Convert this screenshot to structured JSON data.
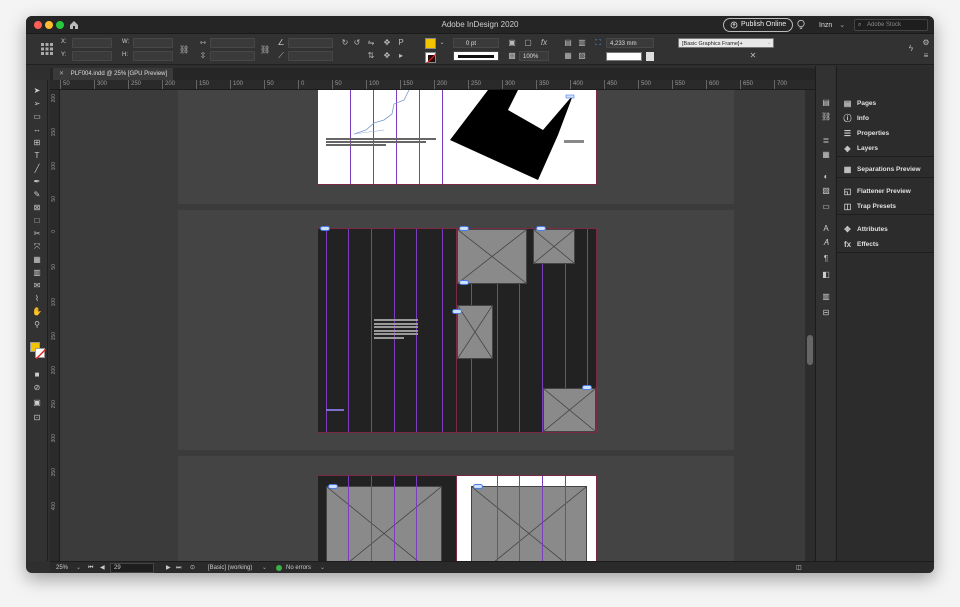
{
  "app": {
    "title": "Adobe InDesign 2020",
    "publish_label": "Publish Online",
    "workspace": "Inzn",
    "stock_placeholder": "Adobe Stock"
  },
  "colors": {
    "accent_fill": "#f5c400",
    "frame_gray": "#8a8a8a",
    "column_guide": "#7c3cbf",
    "margin_guide": "#7a2a45",
    "status_ok": "#3cb043"
  },
  "control_bar": {
    "x_label": "X:",
    "y_label": "Y:",
    "w_label": "W:",
    "h_label": "H:",
    "stroke_weight": "0 pt",
    "reference_value": "4,233 mm",
    "opacity": "100%",
    "object_style": "[Basic Graphics Frame]+"
  },
  "document": {
    "tab_label": "PLF004.indd @ 25% [GPU Preview]"
  },
  "ruler": {
    "h_ticks": [
      "50",
      "300",
      "250",
      "200",
      "150",
      "100",
      "50",
      "0",
      "50",
      "100",
      "150",
      "200",
      "250",
      "300",
      "350",
      "400",
      "450",
      "500",
      "550",
      "600",
      "650",
      "700"
    ],
    "v_ticks": [
      "200",
      "150",
      "100",
      "50",
      "0",
      "50",
      "100",
      "150",
      "200",
      "250",
      "300",
      "350",
      "400"
    ]
  },
  "tools": [
    "selection-tool",
    "direct-selection-tool",
    "page-tool",
    "gap-tool",
    "content-collector-tool",
    "type-tool",
    "line-tool",
    "pen-tool",
    "pencil-tool",
    "rectangle-frame-tool",
    "rectangle-tool",
    "scissors-tool",
    "free-transform-tool",
    "gradient-swatch-tool",
    "gradient-feather-tool",
    "note-tool",
    "eyedropper-tool",
    "hand-tool",
    "zoom-tool"
  ],
  "panels": {
    "group1": [
      {
        "label": "Pages",
        "icon": "pages-icon"
      },
      {
        "label": "Info",
        "icon": "info-icon"
      },
      {
        "label": "Properties",
        "icon": "properties-icon"
      },
      {
        "label": "Layers",
        "icon": "layers-icon"
      }
    ],
    "group2": [
      {
        "label": "Separations Preview",
        "icon": "separations-icon"
      }
    ],
    "group3": [
      {
        "label": "Flattener Preview",
        "icon": "flattener-icon"
      },
      {
        "label": "Trap Presets",
        "icon": "trap-icon"
      }
    ],
    "group4": [
      {
        "label": "Attributes",
        "icon": "attributes-icon"
      },
      {
        "label": "Effects",
        "icon": "effects-icon"
      }
    ]
  },
  "status": {
    "zoom": "25%",
    "page_number": "29",
    "preflight_profile": "[Basic] (working)",
    "errors": "No errors"
  }
}
